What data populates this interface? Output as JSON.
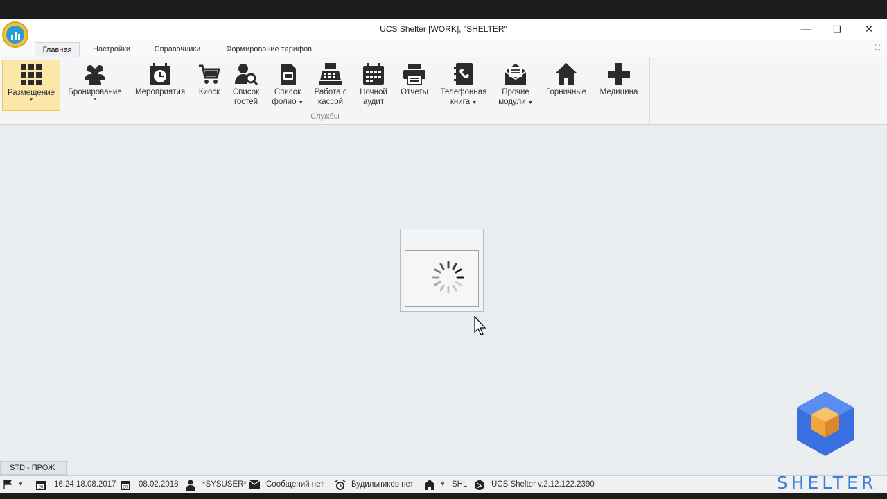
{
  "window": {
    "title": "UCS Shelter [WORK], \"SHELTER\"",
    "minimize_label": "—",
    "restore_label": "❐",
    "close_label": "✕"
  },
  "tabs": [
    {
      "label": "Главная",
      "active": true
    },
    {
      "label": "Настройки"
    },
    {
      "label": "Справочники"
    },
    {
      "label": "Формирование тарифов"
    }
  ],
  "ribbon": {
    "group_caption": "Службы",
    "buttons": [
      {
        "label": "Размещение",
        "icon": "grid-icon"
      },
      {
        "label": "Бронирование",
        "icon": "people-icon"
      },
      {
        "label": "Мероприятия",
        "icon": "calendar-clock-icon"
      },
      {
        "label": "Киоск",
        "icon": "cart-icon"
      },
      {
        "label_1": "Список",
        "label_2": "гостей",
        "icon": "guest-search-icon"
      },
      {
        "label_1": "Список",
        "label_2": "фолио",
        "icon": "folio-icon"
      },
      {
        "label_1": "Работа с",
        "label_2": "кассой",
        "icon": "cash-register-icon"
      },
      {
        "label_1": "Ночной",
        "label_2": "аудит",
        "icon": "night-audit-icon"
      },
      {
        "label": "Отчеты",
        "icon": "printer-icon"
      },
      {
        "label_1": "Телефонная",
        "label_2": "книга",
        "icon": "phonebook-icon"
      },
      {
        "label_1": "Прочие",
        "label_2": "модули",
        "icon": "envelope-icon"
      },
      {
        "label": "Горничные",
        "icon": "house-icon"
      },
      {
        "label": "Медицина",
        "icon": "medical-cross-icon"
      }
    ]
  },
  "mode_label": "STD - ПРОЖ",
  "status": {
    "datetime": "16:24 18.08.2017",
    "date2": "08.02.2018",
    "user": "*SYSUSER*",
    "messages": "Сообщений нет",
    "alarms": "Будильников нет",
    "hotel": "SHL",
    "version": "UCS Shelter v.2.12.122.2390",
    "calendar_day": "20"
  },
  "brand": {
    "word": "SHELTER",
    "colors": {
      "blue": "#3d7fd4",
      "orange": "#f0a63c"
    }
  },
  "colors": {
    "ribbon_active": "#fbe7a8",
    "background": "#eaedef"
  }
}
